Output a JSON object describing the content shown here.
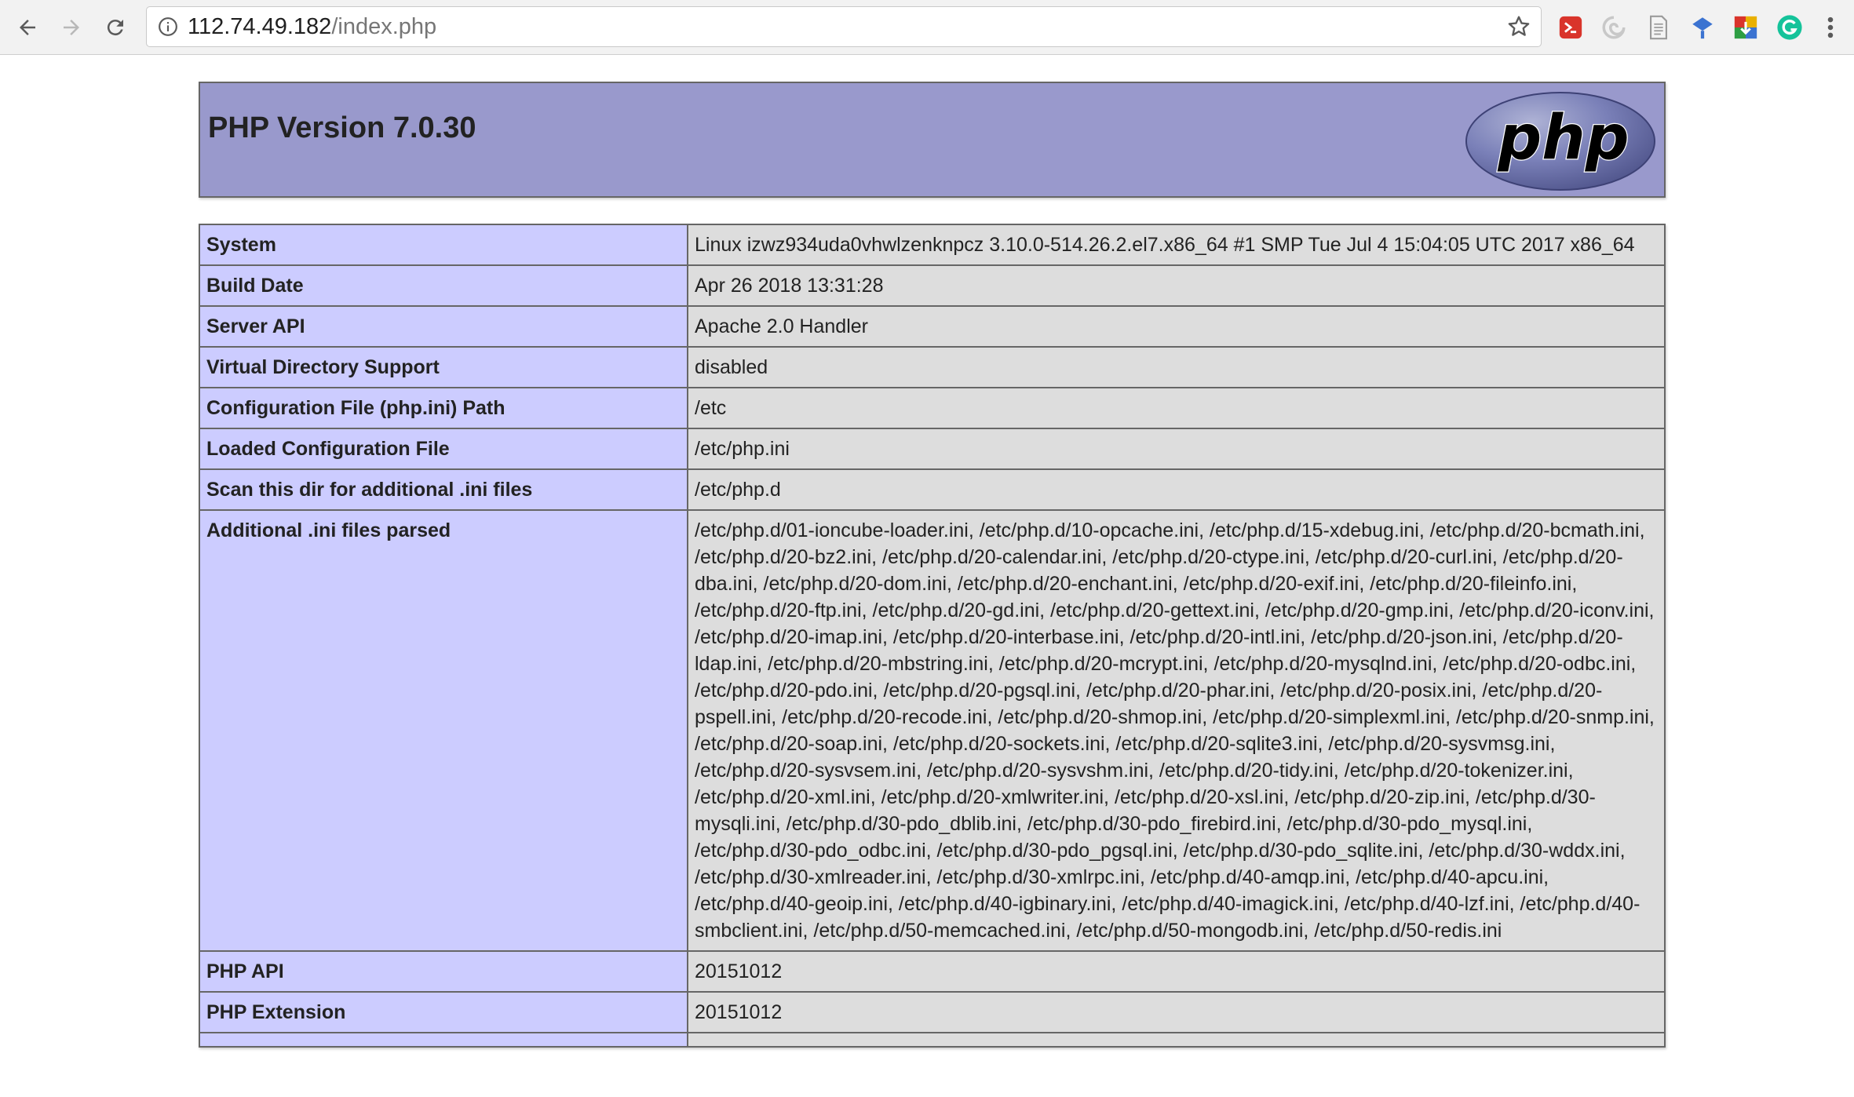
{
  "browser": {
    "url_host": "112.74.49.182",
    "url_path": "/index.php",
    "icons": {
      "back": "arrow-left-icon",
      "forward": "arrow-right-icon",
      "reload": "reload-icon",
      "info": "info-circle-icon",
      "bookmark": "star-icon",
      "menu": "kebab-menu-icon"
    },
    "extensions": [
      {
        "name": "red-extension-icon",
        "color": "#d9342b"
      },
      {
        "name": "swirl-extension-icon",
        "color": "#c8c8c8"
      },
      {
        "name": "document-extension-icon",
        "color": "#9a9a9a"
      },
      {
        "name": "blue-shape-extension-icon",
        "color": "#3b73d1"
      },
      {
        "name": "colorful-extension-icon",
        "color": "#e9b000"
      },
      {
        "name": "grammarly-extension-icon",
        "color": "#15c39a"
      }
    ]
  },
  "header": {
    "title": "PHP Version 7.0.30",
    "logo_text": "php",
    "bg_color": "#9999cc"
  },
  "rows": [
    {
      "label": "System",
      "value": "Linux izwz934uda0vhwlzenknpcz 3.10.0-514.26.2.el7.x86_64 #1 SMP Tue Jul 4 15:04:05 UTC 2017 x86_64"
    },
    {
      "label": "Build Date",
      "value": "Apr 26 2018 13:31:28"
    },
    {
      "label": "Server API",
      "value": "Apache 2.0 Handler"
    },
    {
      "label": "Virtual Directory Support",
      "value": "disabled"
    },
    {
      "label": "Configuration File (php.ini) Path",
      "value": "/etc"
    },
    {
      "label": "Loaded Configuration File",
      "value": "/etc/php.ini"
    },
    {
      "label": "Scan this dir for additional .ini files",
      "value": "/etc/php.d"
    },
    {
      "label": "Additional .ini files parsed",
      "value": "/etc/php.d/01-ioncube-loader.ini, /etc/php.d/10-opcache.ini, /etc/php.d/15-xdebug.ini, /etc/php.d/20-bcmath.ini, /etc/php.d/20-bz2.ini, /etc/php.d/20-calendar.ini, /etc/php.d/20-ctype.ini, /etc/php.d/20-curl.ini, /etc/php.d/20-dba.ini, /etc/php.d/20-dom.ini, /etc/php.d/20-enchant.ini, /etc/php.d/20-exif.ini, /etc/php.d/20-fileinfo.ini, /etc/php.d/20-ftp.ini, /etc/php.d/20-gd.ini, /etc/php.d/20-gettext.ini, /etc/php.d/20-gmp.ini, /etc/php.d/20-iconv.ini, /etc/php.d/20-imap.ini, /etc/php.d/20-interbase.ini, /etc/php.d/20-intl.ini, /etc/php.d/20-json.ini, /etc/php.d/20-ldap.ini, /etc/php.d/20-mbstring.ini, /etc/php.d/20-mcrypt.ini, /etc/php.d/20-mysqlnd.ini, /etc/php.d/20-odbc.ini, /etc/php.d/20-pdo.ini, /etc/php.d/20-pgsql.ini, /etc/php.d/20-phar.ini, /etc/php.d/20-posix.ini, /etc/php.d/20-pspell.ini, /etc/php.d/20-recode.ini, /etc/php.d/20-shmop.ini, /etc/php.d/20-simplexml.ini, /etc/php.d/20-snmp.ini, /etc/php.d/20-soap.ini, /etc/php.d/20-sockets.ini, /etc/php.d/20-sqlite3.ini, /etc/php.d/20-sysvmsg.ini, /etc/php.d/20-sysvsem.ini, /etc/php.d/20-sysvshm.ini, /etc/php.d/20-tidy.ini, /etc/php.d/20-tokenizer.ini, /etc/php.d/20-xml.ini, /etc/php.d/20-xmlwriter.ini, /etc/php.d/20-xsl.ini, /etc/php.d/20-zip.ini, /etc/php.d/30-mysqli.ini, /etc/php.d/30-pdo_dblib.ini, /etc/php.d/30-pdo_firebird.ini, /etc/php.d/30-pdo_mysql.ini, /etc/php.d/30-pdo_odbc.ini, /etc/php.d/30-pdo_pgsql.ini, /etc/php.d/30-pdo_sqlite.ini, /etc/php.d/30-wddx.ini, /etc/php.d/30-xmlreader.ini, /etc/php.d/30-xmlrpc.ini, /etc/php.d/40-amqp.ini, /etc/php.d/40-apcu.ini, /etc/php.d/40-geoip.ini, /etc/php.d/40-igbinary.ini, /etc/php.d/40-imagick.ini, /etc/php.d/40-lzf.ini, /etc/php.d/40-smbclient.ini, /etc/php.d/50-memcached.ini, /etc/php.d/50-mongodb.ini, /etc/php.d/50-redis.ini"
    },
    {
      "label": "PHP API",
      "value": "20151012"
    },
    {
      "label": "PHP Extension",
      "value": "20151012"
    },
    {
      "label": "",
      "value": ""
    }
  ],
  "colors": {
    "label_bg": "#ccccff",
    "value_bg": "#dddddd",
    "border": "#666666"
  }
}
